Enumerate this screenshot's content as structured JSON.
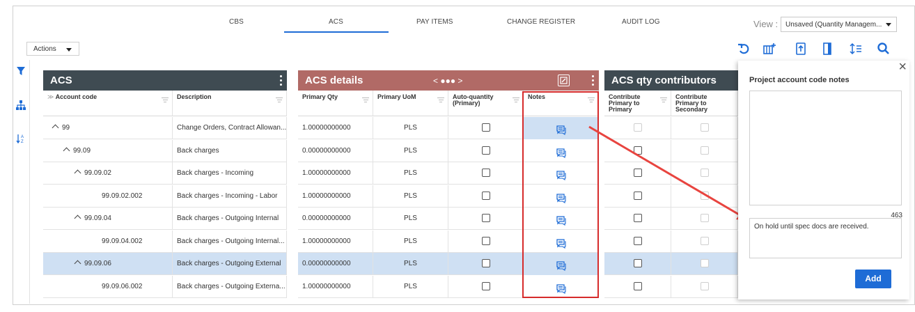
{
  "tabs": [
    "CBS",
    "ACS",
    "PAY ITEMS",
    "CHANGE REGISTER",
    "AUDIT LOG"
  ],
  "active_tab": "ACS",
  "view": {
    "label": "View :",
    "value": "Unsaved (Quantity Managem..."
  },
  "actions_label": "Actions",
  "toolbar_icons": [
    "refresh-icon",
    "add-column-icon",
    "export-icon",
    "panel-icon",
    "row-height-icon",
    "search-icon"
  ],
  "rail_icons": [
    "filter-icon",
    "hierarchy-icon",
    "sort-az-icon"
  ],
  "acs_panel": {
    "title": "ACS",
    "columns": [
      "Account code",
      "Description"
    ]
  },
  "details_panel": {
    "title": "ACS details",
    "nav": "< ●●● >",
    "columns": [
      "Primary Qty",
      "Primary UoM",
      "Auto-quantity (Primary)",
      "Notes"
    ]
  },
  "contrib_panel": {
    "title": "ACS qty contributors",
    "columns": [
      "Contribute Primary to Primary",
      "Contribute Primary to Secondary"
    ]
  },
  "rows": [
    {
      "code": "99",
      "level": 0,
      "expandable": true,
      "desc": "Change Orders, Contract Allowan...",
      "qty": "1.00000000000",
      "uom": "PLS",
      "selected": false
    },
    {
      "code": "99.09",
      "level": 1,
      "expandable": true,
      "desc": "Back charges",
      "qty": "0.00000000000",
      "uom": "PLS",
      "selected": false
    },
    {
      "code": "99.09.02",
      "level": 2,
      "expandable": true,
      "desc": "Back charges - Incoming",
      "qty": "1.00000000000",
      "uom": "PLS",
      "selected": false
    },
    {
      "code": "99.09.02.002",
      "level": 3,
      "expandable": false,
      "desc": "Back charges - Incoming - Labor",
      "qty": "1.00000000000",
      "uom": "PLS",
      "selected": false
    },
    {
      "code": "99.09.04",
      "level": 2,
      "expandable": true,
      "desc": "Back charges - Outgoing Internal",
      "qty": "0.00000000000",
      "uom": "PLS",
      "selected": false
    },
    {
      "code": "99.09.04.002",
      "level": 3,
      "expandable": false,
      "desc": "Back charges - Outgoing Internal...",
      "qty": "1.00000000000",
      "uom": "PLS",
      "selected": false
    },
    {
      "code": "99.09.06",
      "level": 2,
      "expandable": true,
      "desc": "Back charges - Outgoing External",
      "qty": "0.00000000000",
      "uom": "PLS",
      "selected": true
    },
    {
      "code": "99.09.06.002",
      "level": 3,
      "expandable": false,
      "desc": "Back charges - Outgoing Externa...",
      "qty": "1.00000000000",
      "uom": "PLS",
      "selected": false
    }
  ],
  "notes_panel": {
    "title": "Project account code notes",
    "char_count": "463",
    "note_text": "On hold until spec docs are received.",
    "add_label": "Add"
  },
  "colors": {
    "accent": "#1e6cd6",
    "gray_header": "#3f4b52",
    "red_header": "#b16a66",
    "highlight": "#d62b2b",
    "selected_row": "#cfe0f3"
  }
}
